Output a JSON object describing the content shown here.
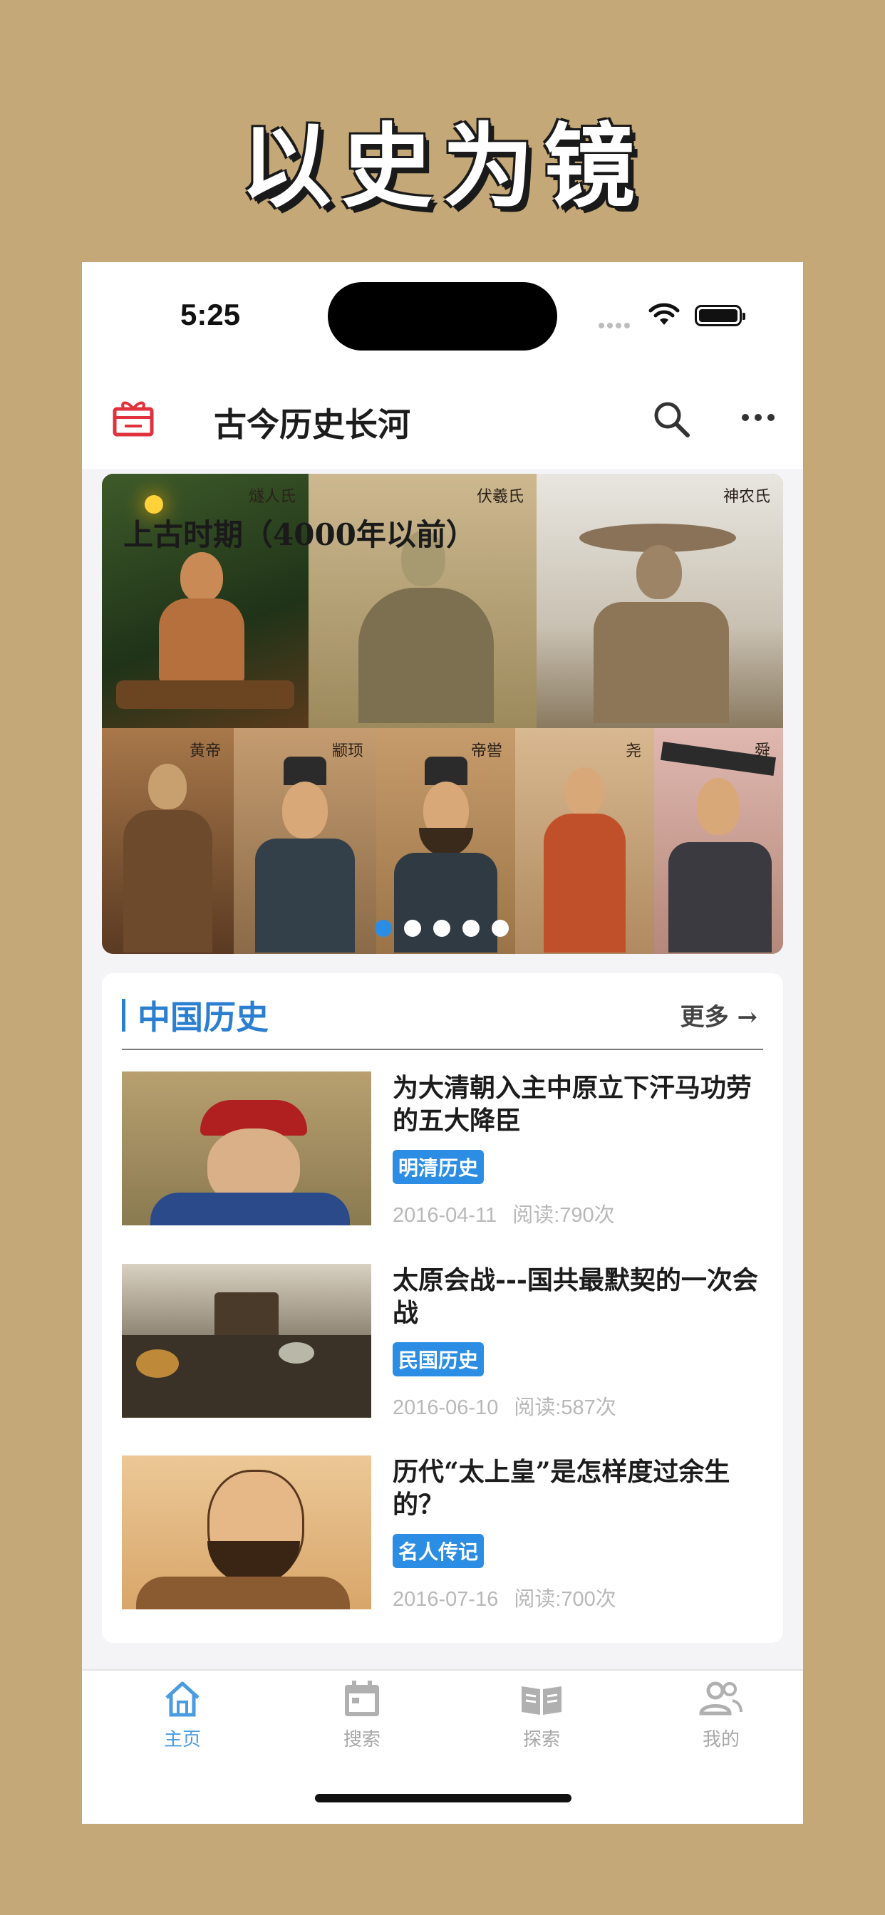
{
  "promo": {
    "title": "以史为镜"
  },
  "status_bar": {
    "time": "5:25"
  },
  "nav": {
    "title": "古今历史长河",
    "icon_left": "gift-icon",
    "icon_search": "search-icon",
    "icon_more": "more-icon"
  },
  "banner": {
    "caption": "上古时期（4000年以前）",
    "slide_count": 5,
    "active_index": 0,
    "figure_labels": [
      "燧人氏",
      "伏羲氏",
      "神农氏",
      "黄帝",
      "颛顼",
      "帝喾",
      "尧",
      "舜"
    ]
  },
  "section": {
    "title": "中国历史",
    "more_label": "更多 →"
  },
  "articles": [
    {
      "title": "为大清朝入主中原立下汗马功劳的五大降臣",
      "tag": "明清历史",
      "date": "2016-04-11",
      "reads": "阅读:790次"
    },
    {
      "title": "太原会战---国共最默契的一次会战",
      "tag": "民国历史",
      "date": "2016-06-10",
      "reads": "阅读:587次"
    },
    {
      "title": "历代“太上皇”是怎样度过余生的？",
      "tag": "名人传记",
      "date": "2016-07-16",
      "reads": "阅读:700次"
    }
  ],
  "tabs": [
    {
      "label": "主页",
      "icon": "home-icon",
      "active": true
    },
    {
      "label": "搜索",
      "icon": "calendar-icon",
      "active": false
    },
    {
      "label": "探索",
      "icon": "book-icon",
      "active": false
    },
    {
      "label": "我的",
      "icon": "users-icon",
      "active": false
    }
  ],
  "colors": {
    "accent": "#2b8de3",
    "background": "#c4a878",
    "gift": "#e0323c"
  }
}
